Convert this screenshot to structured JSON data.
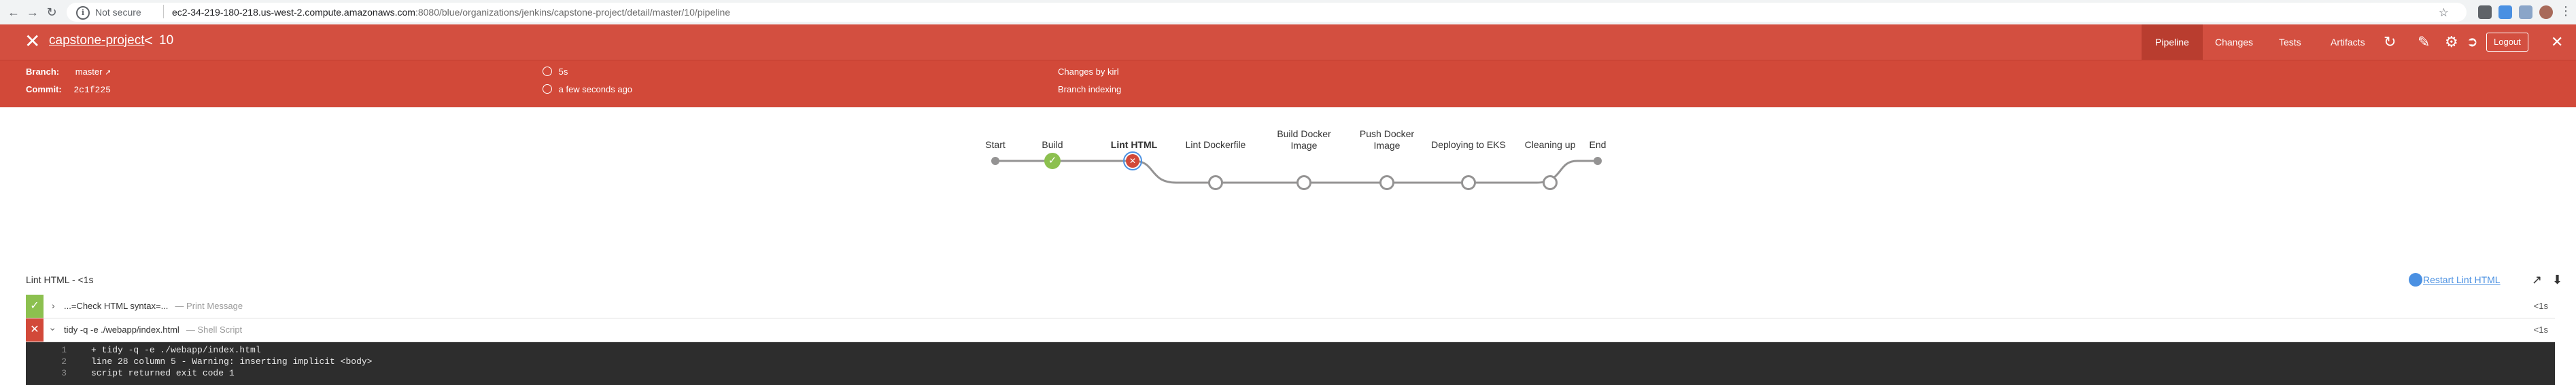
{
  "browser": {
    "not_secure": "Not secure",
    "url_host": "ec2-34-219-180-218.us-west-2.compute.amazonaws.com",
    "url_rest": ":8080/blue/organizations/jenkins/capstone-project/detail/master/10/pipeline"
  },
  "header": {
    "project": "capstone-project",
    "chevron": "<",
    "run_number": "10",
    "tabs": [
      "Pipeline",
      "Changes",
      "Tests",
      "Artifacts"
    ],
    "logout": "Logout",
    "branch_label": "Branch:",
    "branch_value": "master",
    "commit_label": "Commit:",
    "commit_value": "2c1f225",
    "duration": "5s",
    "time_ago": "a few seconds ago",
    "changes": "Changes by kirl",
    "cause": "Branch indexing"
  },
  "pipeline": {
    "stages": [
      {
        "label": "Start",
        "status": "start"
      },
      {
        "label": "Build",
        "status": "success"
      },
      {
        "label": "Lint HTML",
        "status": "failed"
      },
      {
        "label": "Lint Dockerfile",
        "status": "not_built"
      },
      {
        "label": "Build Docker Image",
        "status": "not_built"
      },
      {
        "label": "Push Docker Image",
        "status": "not_built"
      },
      {
        "label": "Deploying to EKS",
        "status": "not_built"
      },
      {
        "label": "Cleaning up",
        "status": "not_built"
      },
      {
        "label": "End",
        "status": "end"
      }
    ]
  },
  "log": {
    "title": "Lint HTML - <1s",
    "restart": "Restart Lint HTML",
    "steps": [
      {
        "name": "...=Check HTML syntax=...",
        "type": "— Print Message",
        "duration": "<1s",
        "status": "success",
        "expanded": false
      },
      {
        "name": "tidy -q -e ./webapp/index.html",
        "type": "— Shell Script",
        "duration": "<1s",
        "status": "failed",
        "expanded": true
      }
    ],
    "console": [
      {
        "num": "1",
        "text": "+ tidy -q -e ./webapp/index.html"
      },
      {
        "num": "2",
        "text": "line 28 column 5 - Warning: inserting implicit <body>"
      },
      {
        "num": "3",
        "text": "script returned exit code 1"
      }
    ]
  },
  "colors": {
    "header": "#d24939",
    "success": "#8cc04f",
    "failed": "#d24939",
    "not_built": "#949393",
    "link": "#4a90e2"
  }
}
